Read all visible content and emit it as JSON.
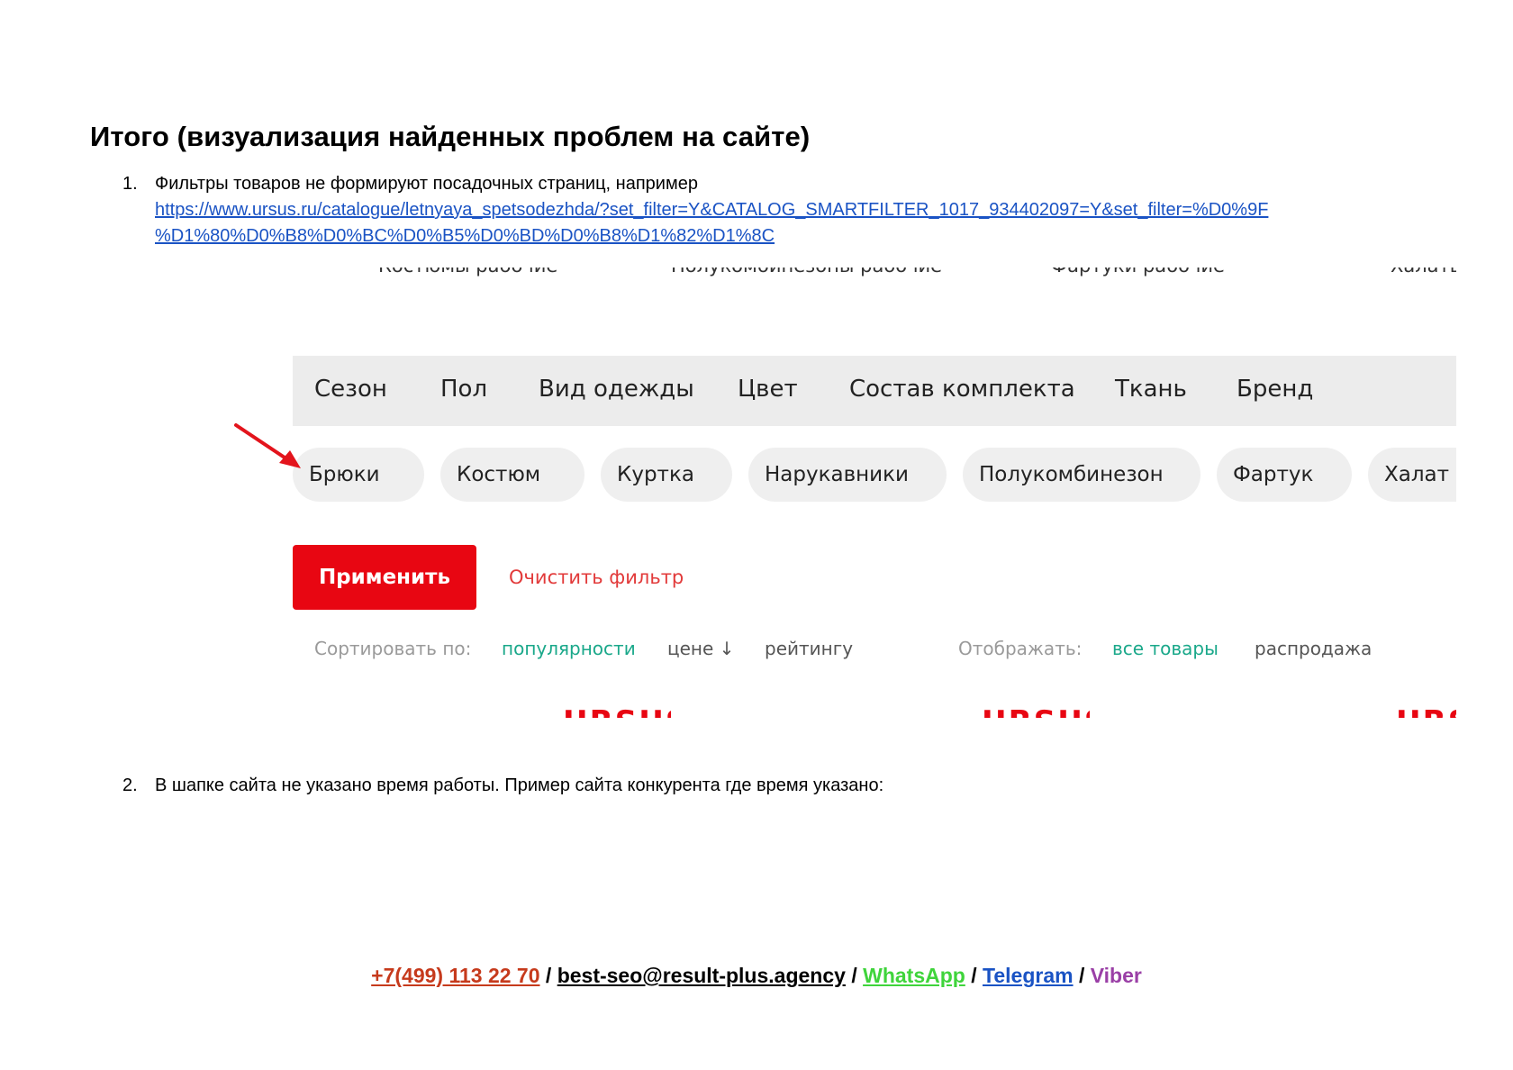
{
  "document": {
    "title": "Итого (визуализация найденных проблем на сайте)",
    "items": [
      {
        "number": "1.",
        "text": "Фильтры товаров не формируют посадочных страниц, например",
        "link_line1": "https://www.ursus.ru/catalogue/letnyaya_spetsodezhda/?set_filter=Y&CATALOG_SMARTFILTER_1017_934402097=Y&set_filter=%D0%9F",
        "link_line2": "%D1%80%D0%B8%D0%BC%D0%B5%D0%BD%D0%B8%D1%82%D1%8C"
      },
      {
        "number": "2.",
        "text": "В шапке сайта не указано время работы. Пример сайта конкурента где время указано:"
      }
    ]
  },
  "screenshot": {
    "categories": [
      "Костюмы рабочие",
      "Полукомбинезоны рабочие",
      "Фартуки рабочие",
      "Халаты"
    ],
    "filter_tabs": [
      "Сезон",
      "Пол",
      "Вид одежды",
      "Цвет",
      "Состав комплекта",
      "Ткань",
      "Бренд"
    ],
    "chips": [
      "Брюки",
      "Костюм",
      "Куртка",
      "Нарукавники",
      "Полукомбинезон",
      "Фартук",
      "Халат"
    ],
    "apply_label": "Применить",
    "clear_label": "Очистить фильтр",
    "sort": {
      "label": "Сортировать по:",
      "options": [
        "популярности",
        "цене ↓",
        "рейтингу"
      ]
    },
    "display": {
      "label": "Отображать:",
      "options": [
        "все товары",
        "распродажа"
      ]
    },
    "logo_fragment": "URSUS",
    "arrow_color": "#e3141c"
  },
  "footer": {
    "phone": "+7(499) 113 22 70",
    "email": "best-seo@result-plus.agency",
    "whatsapp": "WhatsApp",
    "telegram": "Telegram",
    "viber": "Viber",
    "separator": " / "
  }
}
